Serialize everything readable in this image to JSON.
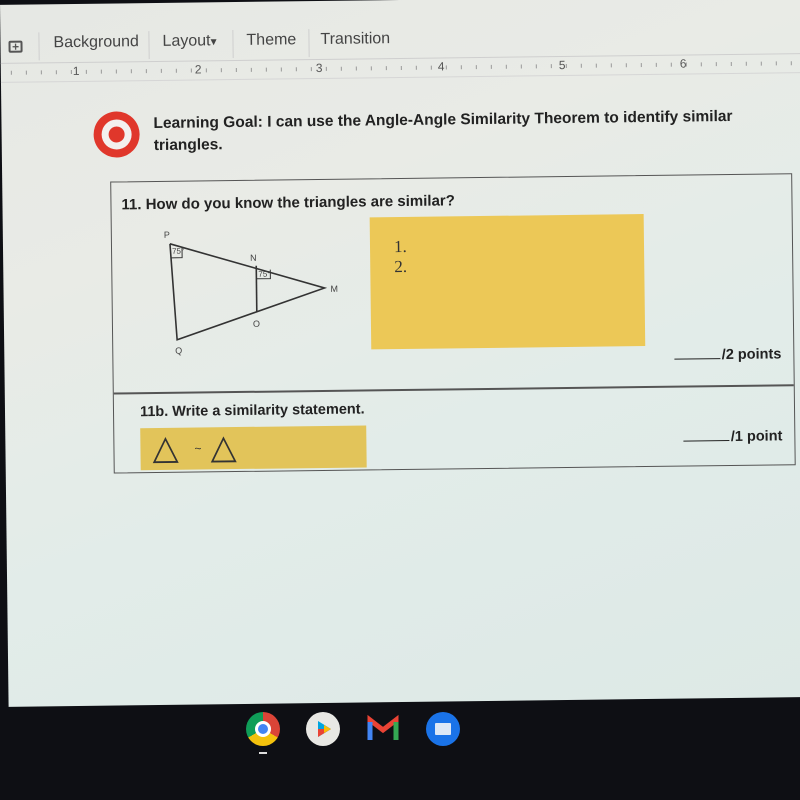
{
  "toolbar": {
    "new_slide_icon": "comment-plus-icon",
    "background_label": "Background",
    "layout_label": "Layout",
    "layout_caret": "▾",
    "theme_label": "Theme",
    "transition_label": "Transition"
  },
  "ruler": {
    "numbers": [
      "1",
      "2",
      "3",
      "4",
      "5",
      "6"
    ]
  },
  "learning_goal": {
    "icon": "target-icon",
    "text": "Learning Goal: I can use the Angle-Angle Similarity Theorem to identify similar triangles."
  },
  "question_11": {
    "title": "11. How do you know the triangles are similar?",
    "diagram": {
      "vertices": {
        "p": "P",
        "n": "N",
        "m": "M",
        "o": "O",
        "q": "Q"
      },
      "angle_p": "75°",
      "angle_n": "75°"
    },
    "answer_lines": [
      "1.",
      "2."
    ],
    "points_suffix": "/2 points"
  },
  "question_11b": {
    "title": "11b. Write a similarity statement.",
    "triangle_symbol": "△",
    "similar_symbol": "~",
    "points_suffix": "/1 point"
  },
  "shelf": {
    "apps": [
      {
        "name": "Chrome",
        "icon": "chrome-icon",
        "active": true
      },
      {
        "name": "Play Store",
        "icon": "play-store-icon",
        "active": false
      },
      {
        "name": "Gmail",
        "icon": "gmail-icon",
        "active": false
      },
      {
        "name": "Files",
        "icon": "files-icon",
        "active": false
      }
    ]
  },
  "colors": {
    "answer_highlight": "#ecc857",
    "target_red": "#e0372b",
    "shelf_bg": "#0e0f14"
  }
}
